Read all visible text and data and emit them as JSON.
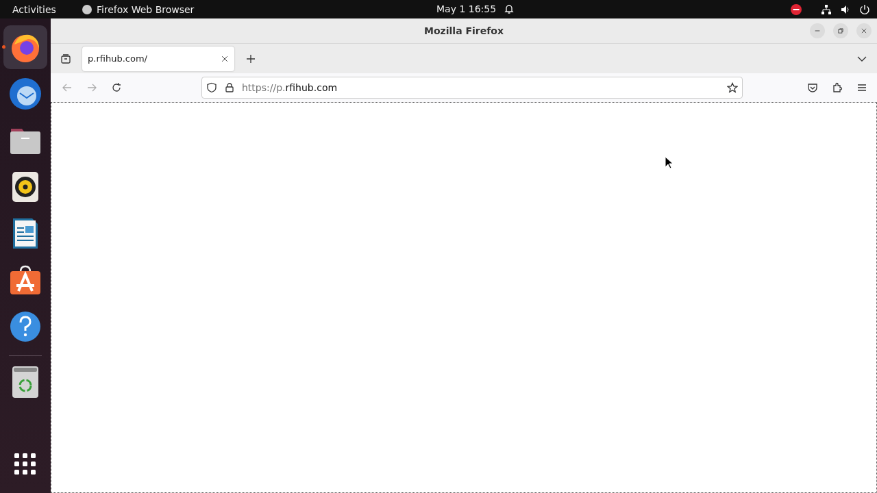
{
  "top_bar": {
    "activities": "Activities",
    "app_name": "Firefox Web Browser",
    "clock": "May 1  16:55"
  },
  "dock": [
    {
      "kind": "firefox",
      "active": true
    },
    {
      "kind": "thunderbird",
      "active": false
    },
    {
      "kind": "files",
      "active": false
    },
    {
      "kind": "rhythmbox",
      "active": false
    },
    {
      "kind": "writer",
      "active": false
    },
    {
      "kind": "software",
      "active": false
    },
    {
      "kind": "help",
      "active": false
    },
    {
      "kind": "separator"
    },
    {
      "kind": "trash",
      "active": false
    }
  ],
  "window": {
    "title": "Mozilla Firefox"
  },
  "tabs": [
    {
      "label": "p.rfihub.com/",
      "selected": true
    }
  ],
  "address_bar": {
    "url_scheme": "https://p.",
    "url_host": "rfihub.com"
  }
}
